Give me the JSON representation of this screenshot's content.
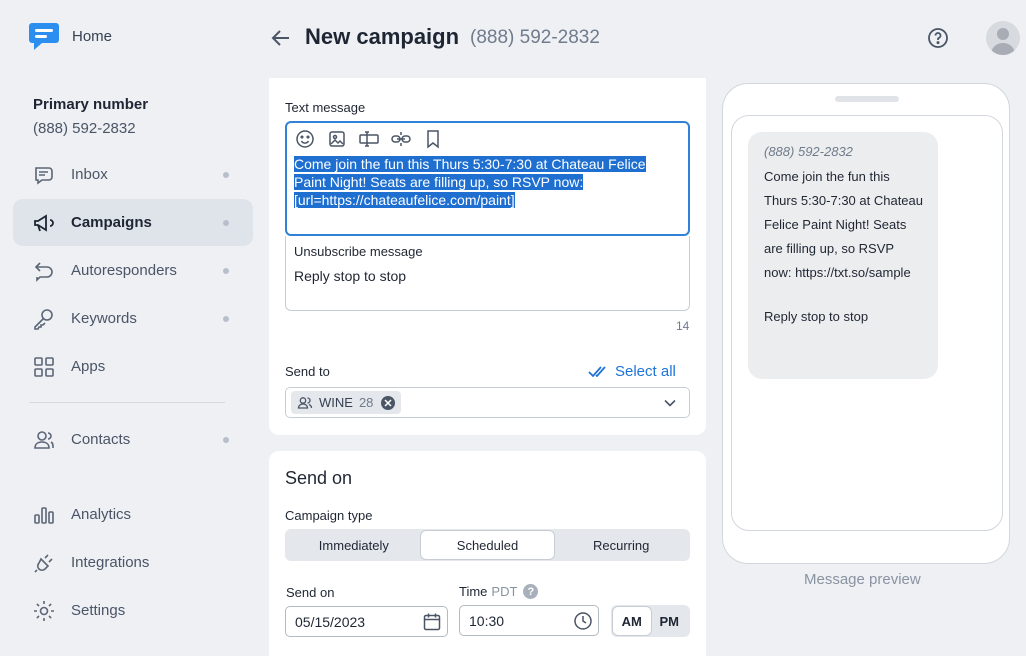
{
  "sidebar": {
    "home_label": "Home",
    "primary_title": "Primary number",
    "primary_number": "(888) 592-2832",
    "items": [
      {
        "label": "Inbox"
      },
      {
        "label": "Campaigns"
      },
      {
        "label": "Autoresponders"
      },
      {
        "label": "Keywords"
      },
      {
        "label": "Apps"
      },
      {
        "label": "Contacts"
      },
      {
        "label": "Analytics"
      },
      {
        "label": "Integrations"
      },
      {
        "label": "Settings"
      }
    ]
  },
  "header": {
    "title": "New campaign",
    "subtitle": "(888) 592-2832"
  },
  "message": {
    "label": "Text message",
    "text": "Come join the fun this Thurs 5:30-7:30 at Chateau Felice Paint Night! Seats are filling up, so RSVP now: [url=https://chateaufelice.com/paint]",
    "unsub_title": "Unsubscribe message",
    "unsub_text": "Reply stop to stop",
    "char_count": "14"
  },
  "send_to": {
    "label": "Send to",
    "select_all": "Select all",
    "chip_name": "WINE",
    "chip_count": "28"
  },
  "send_on": {
    "title": "Send on",
    "campaign_type_label": "Campaign type",
    "types": [
      "Immediately",
      "Scheduled",
      "Recurring"
    ],
    "selected_type": "Scheduled",
    "date_label": "Send on",
    "date_value": "05/15/2023",
    "time_label": "Time",
    "timezone": "PDT",
    "time_value": "10:30",
    "am": "AM",
    "pm": "PM",
    "selected_period": "AM"
  },
  "preview": {
    "number": "(888) 592-2832",
    "text": "Come join the fun this Thurs 5:30-7:30 at Chateau Felice Paint Night! Seats are filling up, so RSVP now: https://txt.so/sample",
    "unsub": "Reply stop to stop",
    "label": "Message preview"
  },
  "colors": {
    "accent": "#1e73d8",
    "selection": "#1e6fd0",
    "logo": "#2c8ff0"
  }
}
